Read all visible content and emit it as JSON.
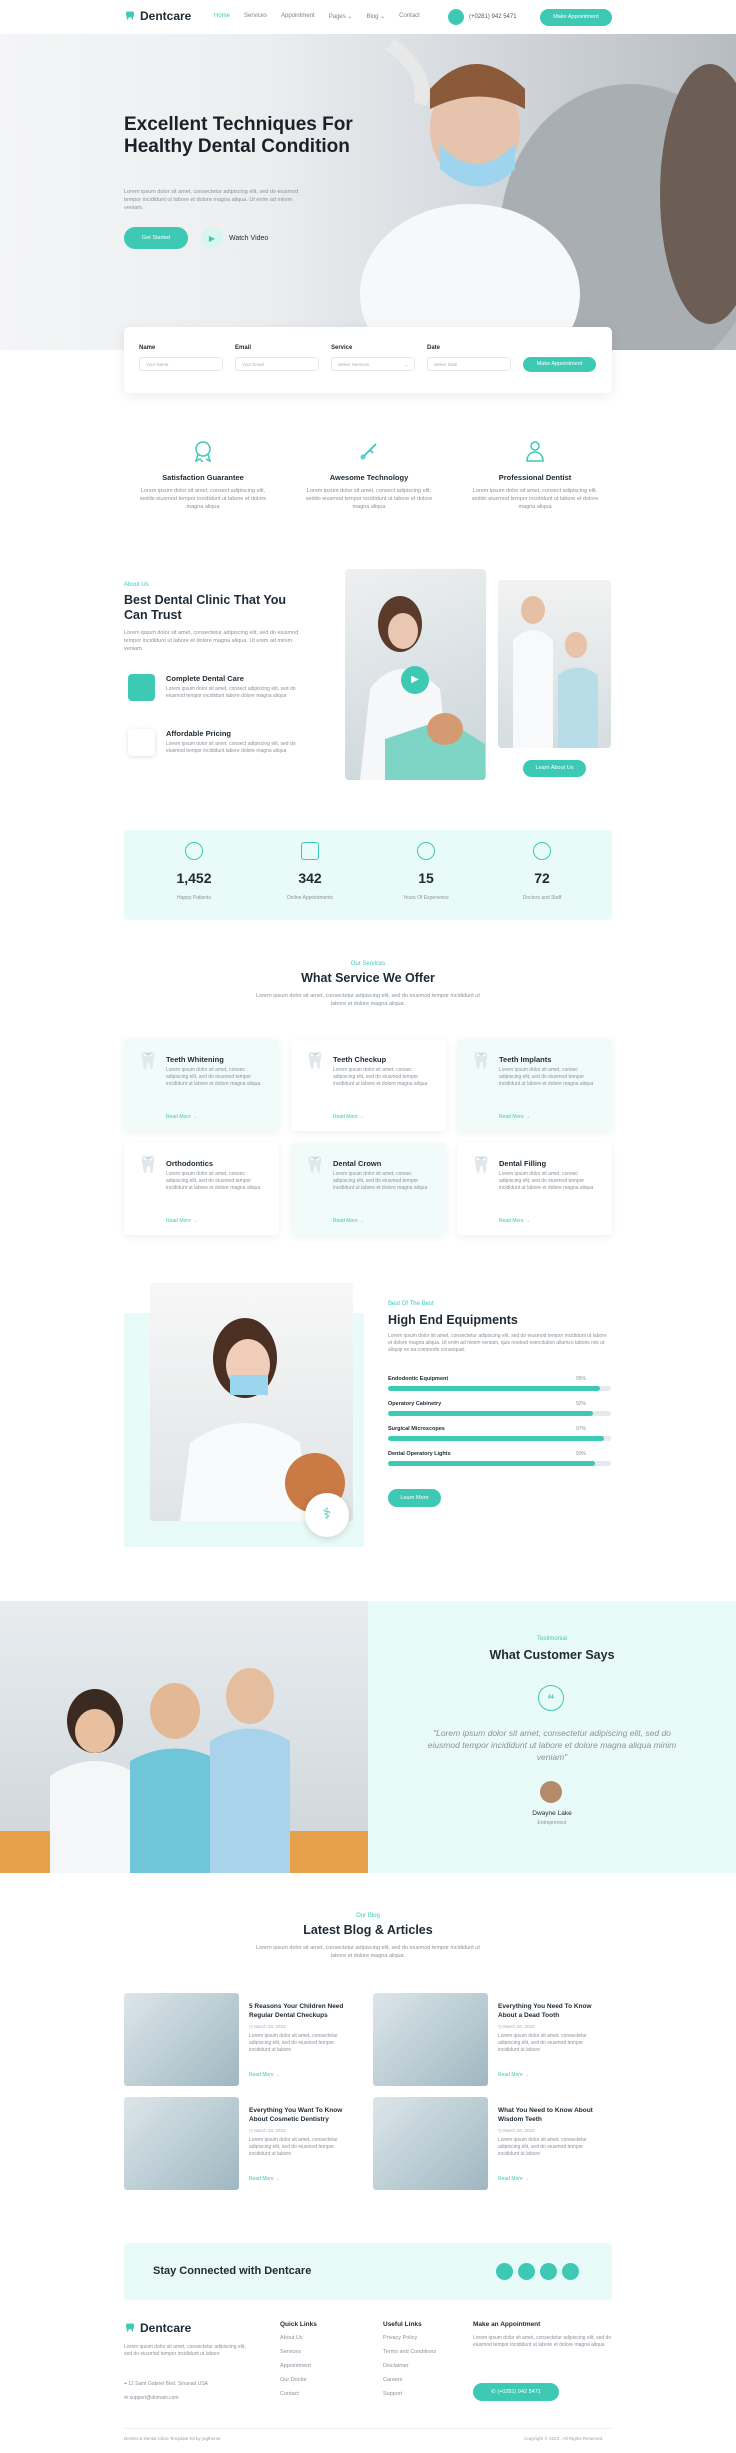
{
  "brand": {
    "name": "Dentcare",
    "accent": "#3ec9b4"
  },
  "nav": {
    "items": [
      "Home",
      "Services",
      "Appointment",
      "Pages",
      "Blog",
      "Contact"
    ],
    "pages_label": "Pages",
    "blog_label": "Blog",
    "phone": "(+0281) 942 5471",
    "cta": "Make Appointment"
  },
  "hero": {
    "title": "Excellent Techniques For Healthy Dental Condition",
    "text": "Lorem ipsum dolor sit amet, consectetur adipiscing elit, sed do eiusmod tempor incididunt ut labore et dolore magna aliqua. Ut enim ad minim veniam.",
    "cta": "Get Started",
    "video": "Watch Video"
  },
  "form": {
    "name_label": "Name",
    "name_ph": "Your Name",
    "email_label": "Email",
    "email_ph": "Your Email",
    "service_label": "Service",
    "service_ph": "Select Services",
    "date_label": "Date",
    "date_ph": "Select Date",
    "submit": "Make Appointment"
  },
  "features": [
    {
      "title": "Satisfaction Guarantee",
      "text": "Lorem ipsum dolor sit amet, consect adipiscing elit, seddo eiusmod tempor incididunt ut labore et dolore magna aliqua"
    },
    {
      "title": "Awesome Technology",
      "text": "Lorem ipsum dolor sit amet, consect adipiscing elit, seddo eiusmod tempor incididunt ut labore et dolore magna aliqua"
    },
    {
      "title": "Professional Dentist",
      "text": "Lorem ipsum dolor sit amet, consect adipiscing elit, seddo eiusmod tempor incididunt ut labore et dolore magna aliqua"
    }
  ],
  "about": {
    "tag": "About Us",
    "title": "Best Dental Clinic That You Can Trust",
    "text": "Lorem ipsum dolor sit amet, consectetur adipiscing elit, sed do eiusmod tempor incididunt ut labore et dolore magna aliqua. Ut enim ad minim veniam.",
    "items": [
      {
        "title": "Complete Dental Care",
        "text": "Lorem ipsum dolor sit amet, consect adipiscing elit, sed do eiusmod tempor incididunt labore dolore magna aliqua"
      },
      {
        "title": "Affordable Pricing",
        "text": "Lorem ipsum dolor sit amet, consect adipiscing elit, sed do eiusmod tempor incididunt labore dolore magna aliqua"
      }
    ],
    "cta": "Learn About Us"
  },
  "stats": [
    {
      "value": "1,452",
      "label": "Happy Patients"
    },
    {
      "value": "342",
      "label": "Online Appointments"
    },
    {
      "value": "15",
      "label": "Years Of Experience"
    },
    {
      "value": "72",
      "label": "Doctors and Staff"
    }
  ],
  "services": {
    "tag": "Our Services",
    "title": "What Service We Offer",
    "text": "Lorem ipsum dolor sit amet, consectetur adipiscing elit, sed do eiusmod tempor incididunt ut labore et dolore magna aliqua.",
    "more": "Read More",
    "items": [
      {
        "title": "Teeth Whitening",
        "text": "Lorem ipsum dolor sit amet, consec adipiscing elit, sed do eiusmod tempor incididunt ut labore et dolore magna aliqua"
      },
      {
        "title": "Teeth Checkup",
        "text": "Lorem ipsum dolor sit amet, consec adipiscing elit, sed do eiusmod tempor incididunt ut labore et dolore magna aliqua"
      },
      {
        "title": "Teeth Implants",
        "text": "Lorem ipsum dolor sit amet, consec adipiscing elit, sed do eiusmod tempor incididunt ut labore et dolore magna aliqua"
      },
      {
        "title": "Orthodontics",
        "text": "Lorem ipsum dolor sit amet, consec adipiscing elit, sed do eiusmod tempor incididunt ut labore et dolore magna aliqua"
      },
      {
        "title": "Dental Crown",
        "text": "Lorem ipsum dolor sit amet, consec adipiscing elit, sed do eiusmod tempor incididunt ut labore et dolore magna aliqua"
      },
      {
        "title": "Dental Filling",
        "text": "Lorem ipsum dolor sit amet, consec adipiscing elit, sed do eiusmod tempor incididunt ut labore et dolore magna aliqua"
      }
    ]
  },
  "equip": {
    "tag": "Best Of The Best",
    "title": "High End Equipments",
    "text": "Lorem ipsum dolor sit amet, consectetur adipiscing elit, sed do eiusmod tempor incididunt ut labore et dolore magna aliqua. Ut enim ad minim veniam, quis nostrud exercitation ullamco laboris nisi ut aliquip ex ea commodo consequat.",
    "cta": "Learn More",
    "bars": [
      {
        "label": "Endodontic Equipment",
        "pct": "95%",
        "value": 0.95
      },
      {
        "label": "Operatory Cabinetry",
        "pct": "92%",
        "value": 0.92
      },
      {
        "label": "Surgical Microscopes",
        "pct": "97%",
        "value": 0.97
      },
      {
        "label": "Dental Operatory Lights",
        "pct": "93%",
        "value": 0.93
      }
    ]
  },
  "testimonial": {
    "tag": "Testimonial",
    "title": "What Customer Says",
    "quote": "\"Lorem ipsum dolor sit amet, consectetur adipiscing elit, sed do eiusmod tempor incididunt ut labore et dolore magna aliqua minim veniam\"",
    "name": "Dwayne Lake",
    "role": "Entrepreneur"
  },
  "blog": {
    "tag": "Our Blog",
    "title": "Latest Blog & Articles",
    "text": "Lorem ipsum dolor sit amet, consectetur adipiscing elit, sed do eiusmod tempor incididunt ut labore et dolore magna aliqua.",
    "more": "Read More",
    "posts": [
      {
        "title": "5 Reasons Your Children Need Regular Dental Checkups",
        "date": "March 20, 2023",
        "text": "Lorem ipsum dolor sit amet, consectetur adipiscing elit, sed do eiusmod tempor incididunt ut labore"
      },
      {
        "title": "Everything You Need To Know About a Dead Tooth",
        "date": "March 20, 2023",
        "text": "Lorem ipsum dolor sit amet, consectetur adipiscing elit, sed do eiusmod tempor incididunt ut labore"
      },
      {
        "title": "Everything You Want To Know About Cosmetic Dentistry",
        "date": "March 20, 2023",
        "text": "Lorem ipsum dolor sit amet, consectetur adipiscing elit, sed do eiusmod tempor incididunt ut labore"
      },
      {
        "title": "What You Need to Know About Wisdom Teeth",
        "date": "March 20, 2023",
        "text": "Lorem ipsum dolor sit amet, consectetur adipiscing elit, sed do eiusmod tempor incididunt ut labore"
      }
    ]
  },
  "connect": {
    "title": "Stay Connected with Dentcare"
  },
  "footer": {
    "about": "Lorem ipsum dolor sit amet, consectetur adipiscing elit, sed do eiusmod tempor incididunt ut labore",
    "address": "12 Saint Gabriel Blvd, Sinanad USA",
    "email": "support@domain.com",
    "quick_title": "Quick Links",
    "quick": [
      "About Us",
      "Services",
      "Appointment",
      "Our Doctor",
      "Contact"
    ],
    "useful_title": "Useful Links",
    "useful": [
      "Privacy Policy",
      "Terms and Conditions",
      "Disclaimer",
      "Careers",
      "Support"
    ],
    "appt_title": "Make an Appointment",
    "appt_text": "Lorem ipsum dolor sit amet, consectetur adipiscing elit, sed do eiusmod tempor incididunt ut labore et dolore magna aliqua",
    "phone": "(+0281) 942 5471",
    "credit": "Dentist & Dental Clinic Template Kit by jegtheme",
    "copyright": "Copyright © 2023 . All Rights Reserved."
  }
}
